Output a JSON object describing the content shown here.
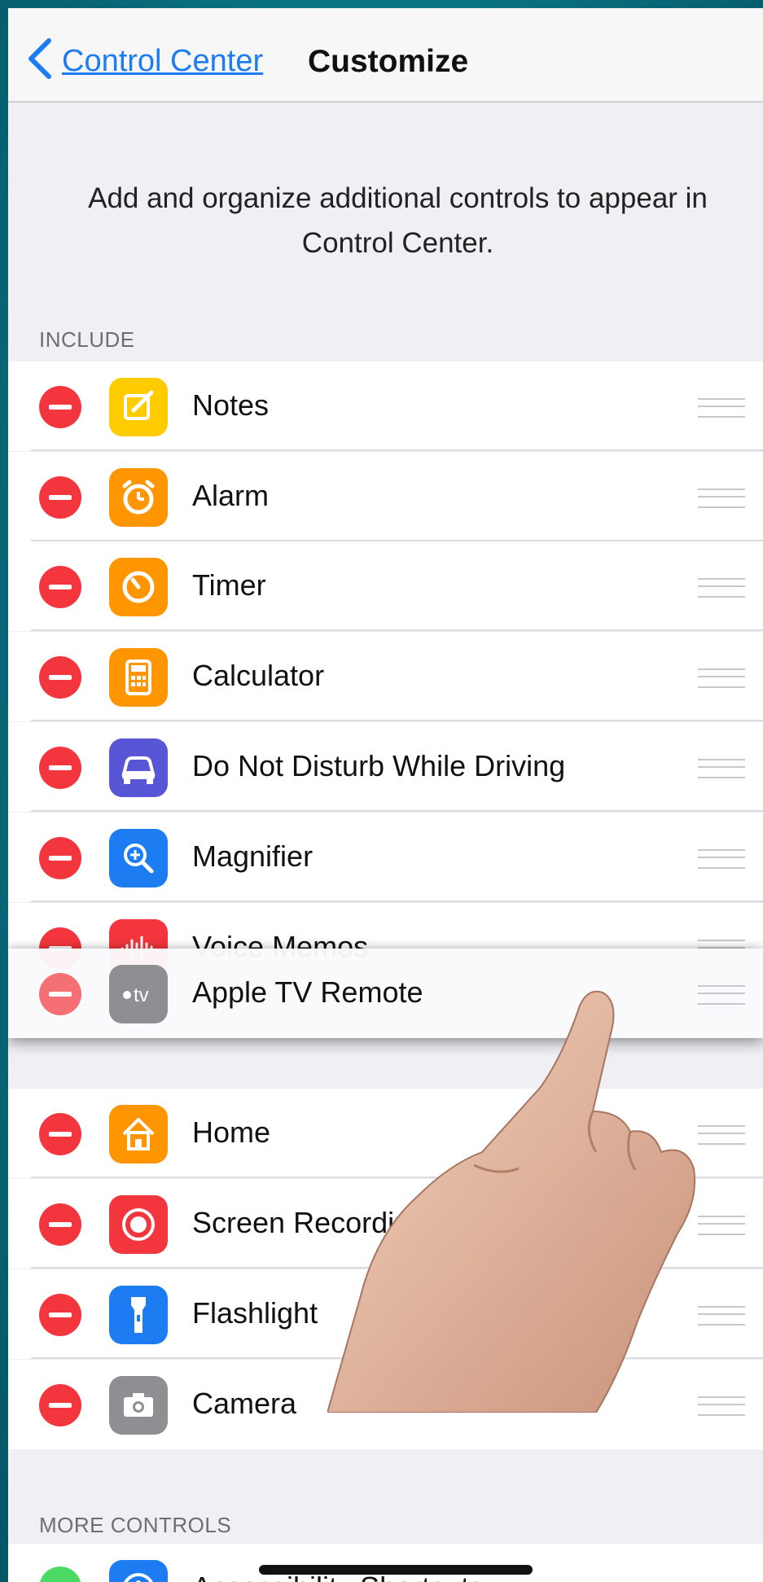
{
  "nav": {
    "back_label": "Control Center",
    "title": "Customize"
  },
  "description": "Add and organize additional controls to appear in Control Center.",
  "include": {
    "header": "INCLUDE",
    "items": [
      {
        "label": "Notes",
        "icon": "notes-icon",
        "color": "#ffcc00"
      },
      {
        "label": "Alarm",
        "icon": "alarm-icon",
        "color": "#ff9500"
      },
      {
        "label": "Timer",
        "icon": "timer-icon",
        "color": "#ff9500"
      },
      {
        "label": "Calculator",
        "icon": "calculator-icon",
        "color": "#ff9500"
      },
      {
        "label": "Do Not Disturb While Driving",
        "icon": "car-icon",
        "color": "#5856d6"
      },
      {
        "label": "Magnifier",
        "icon": "magnifier-icon",
        "color": "#1e7cf2"
      },
      {
        "label": "Voice Memos",
        "icon": "voice-memos-icon",
        "color": "#f3363d"
      },
      {
        "label": "Home",
        "icon": "home-icon",
        "color": "#ff9500"
      },
      {
        "label": "Screen Recording",
        "icon": "screen-recording-icon",
        "color": "#f3363d"
      },
      {
        "label": "Flashlight",
        "icon": "flashlight-icon",
        "color": "#1e7cf2"
      },
      {
        "label": "Camera",
        "icon": "camera-icon",
        "color": "#8e8e93"
      }
    ],
    "dragging": {
      "label": "Apple TV Remote",
      "icon": "apple-tv-icon",
      "color": "#8e8e93",
      "icon_text": "tv"
    }
  },
  "more_controls": {
    "header": "MORE CONTROLS",
    "items": [
      {
        "label": "Accessibility Shortcuts",
        "icon": "accessibility-icon",
        "color": "#1e7cf2"
      }
    ]
  },
  "colors": {
    "accent": "#1e7cf2",
    "delete": "#f3363d",
    "add": "#4cd964"
  }
}
